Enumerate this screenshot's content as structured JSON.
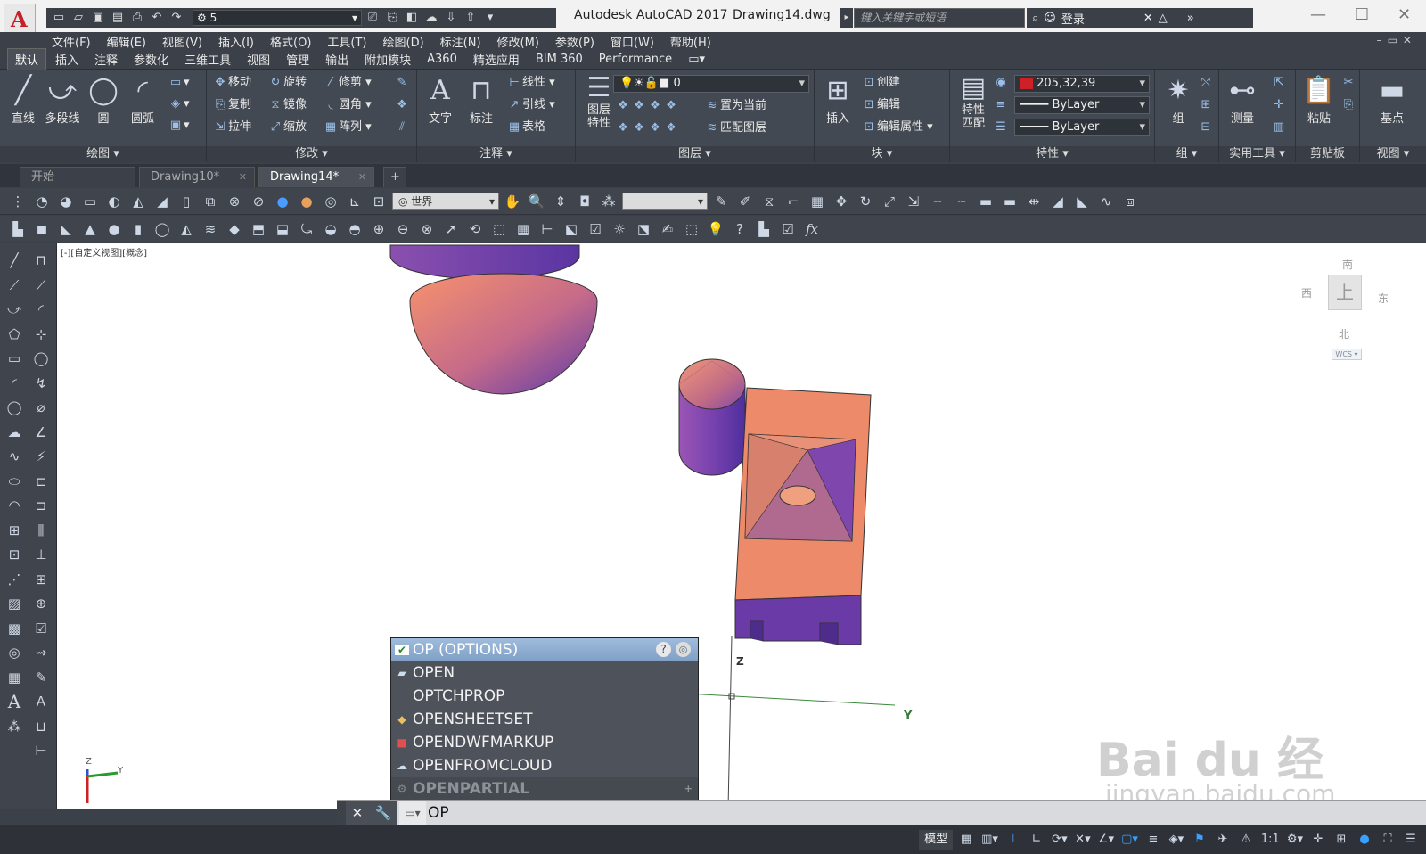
{
  "titlebar": {
    "app_title": "Autodesk AutoCAD 2017",
    "file_name": "Drawing14.dwg",
    "workspace": "5",
    "search_placeholder": "键入关键字或短语",
    "login": "登录"
  },
  "menubar": {
    "items": [
      "文件(F)",
      "编辑(E)",
      "视图(V)",
      "插入(I)",
      "格式(O)",
      "工具(T)",
      "绘图(D)",
      "标注(N)",
      "修改(M)",
      "参数(P)",
      "窗口(W)",
      "帮助(H)"
    ]
  },
  "ribbon_tabs": [
    "默认",
    "插入",
    "注释",
    "参数化",
    "三维工具",
    "视图",
    "管理",
    "输出",
    "附加模块",
    "A360",
    "精选应用",
    "BIM 360",
    "Performance"
  ],
  "ribbon": {
    "draw": {
      "title": "绘图",
      "line": "直线",
      "polyline": "多段线",
      "circle": "圆",
      "arc": "圆弧"
    },
    "modify": {
      "title": "修改",
      "move": "移动",
      "rotate": "旋转",
      "trim": "修剪",
      "copy": "复制",
      "mirror": "镜像",
      "fillet": "圆角",
      "stretch": "拉伸",
      "scale": "缩放",
      "array": "阵列"
    },
    "annotation": {
      "title": "注释",
      "text": "文字",
      "dimension": "标注",
      "linear": "线性",
      "leader": "引线",
      "table": "表格"
    },
    "layers": {
      "title": "图层",
      "layer_props": "图层\n特性",
      "current_layer": "0",
      "set_current": "置为当前",
      "match_layer": "匹配图层"
    },
    "block": {
      "title": "块",
      "insert": "插入",
      "create": "创建",
      "edit": "编辑",
      "edit_attr": "编辑属性"
    },
    "properties": {
      "title": "特性",
      "match": "特性\n匹配",
      "color": "205,32,39",
      "linetype": "ByLayer",
      "lineweight": "ByLayer"
    },
    "groups": {
      "title": "组",
      "group": "组"
    },
    "utilities": {
      "title": "实用工具",
      "measure": "测量"
    },
    "clipboard": {
      "title": "剪贴板",
      "paste": "粘贴"
    },
    "view": {
      "title": "视图",
      "base": "基点"
    }
  },
  "doc_tabs": [
    {
      "label": "开始"
    },
    {
      "label": "Drawing10*"
    },
    {
      "label": "Drawing14*"
    }
  ],
  "toolbar": {
    "ucs_dropdown": "世界"
  },
  "canvas": {
    "view_label": "[-][自定义视图][概念]",
    "axis_z": "Z",
    "axis_y": "Y",
    "ucs_z": "Z",
    "ucs_y": "Y",
    "viewcube": {
      "north": "南",
      "west": "西",
      "east": "东",
      "south": "北",
      "top": "上",
      "wcs": "WCS"
    }
  },
  "autocomplete": {
    "items": [
      {
        "label": "OP (OPTIONS)",
        "selected": true
      },
      {
        "label": "OPEN"
      },
      {
        "label": "OPTCHPROP"
      },
      {
        "label": "OPENSHEETSET"
      },
      {
        "label": "OPENDWFMARKUP"
      },
      {
        "label": "OPENFROMCLOUD"
      },
      {
        "label": "OPENPARTIAL",
        "dim": true
      }
    ]
  },
  "cmdline": {
    "value": "OP"
  },
  "statusbar": {
    "model": "模型",
    "scale": "1:1"
  },
  "watermark": {
    "main": "Bai du 经验",
    "sub": "jingyan.baidu.com"
  }
}
